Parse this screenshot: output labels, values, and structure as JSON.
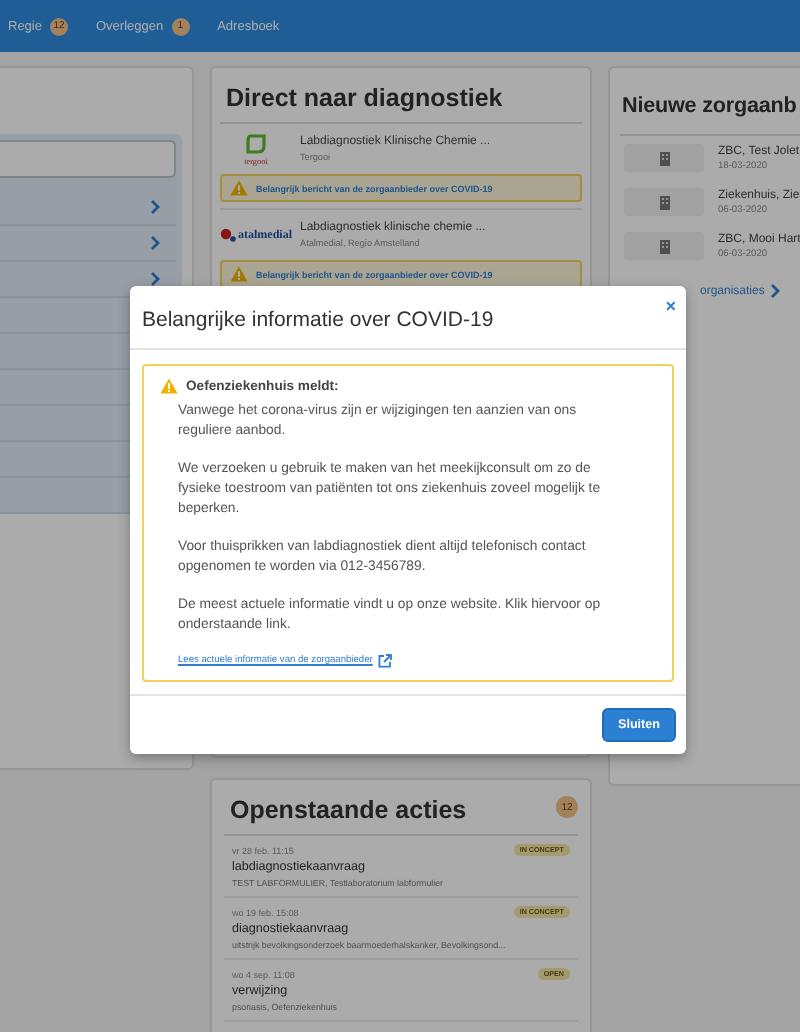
{
  "nav": [
    {
      "label": "Regie",
      "badge": "12"
    },
    {
      "label": "Overleggen",
      "badge": "1"
    },
    {
      "label": "Adresboek"
    }
  ],
  "diagnostics": {
    "title": "Direct naar diagnostiek",
    "providers": [
      {
        "logo_text": "tergooi",
        "kind": "leaf",
        "name": "Labdiagnostiek Klinische Chemie ...",
        "location": "Tergooi",
        "notice": "Belangrijk bericht van de zorgaanbieder over COVID-19"
      },
      {
        "logo_text": "atalmedial",
        "kind": "dots",
        "name": "Labdiagnostiek klinische chemie ...",
        "location": "Atalmedial, Regio Amstelland",
        "notice": "Belangrijk bericht van de zorgaanbieder over COVID-19"
      }
    ]
  },
  "new_providers": {
    "title": "Nieuwe zorgaanb",
    "items": [
      {
        "name": "ZBC, Test Jolet",
        "date": "18-03-2020"
      },
      {
        "name": "Ziekenhuis, Zie",
        "date": "06-03-2020"
      },
      {
        "name": "ZBC, Mooi Hart",
        "date": "06-03-2020"
      }
    ],
    "link": "organisaties"
  },
  "actions": {
    "title": "Openstaande acties",
    "count": "12",
    "items": [
      {
        "date": "vr 28 feb. 11:15",
        "status": "IN CONCEPT",
        "title": "labdiagnostiekaanvraag",
        "detail": "TEST LABFORMULIER, Testlaboratorium labformulier"
      },
      {
        "date": "wo 19 feb. 15:08",
        "status": "IN CONCEPT",
        "title": "diagnostiekaanvraag",
        "detail": "uitstrijk bevolkingsonderzoek baarmoederhalskanker, Bevolkingsond..."
      },
      {
        "date": "wo 4 sep. 11:08",
        "status": "OPEN",
        "title": "verwijzing",
        "detail": "psoriasis, Oefenziekenhuis"
      }
    ]
  },
  "modal": {
    "title": "Belangrijke informatie over COVID-19",
    "close": "×",
    "sender": "Oefenziekenhuis meldt:",
    "paragraphs": [
      "Vanwege het corona-virus zijn er wijzigingen ten aanzien van ons reguliere aanbod.",
      "We verzoeken u gebruik te maken van het meekijkconsult om zo de fysieke toestroom van patiënten tot ons ziekenhuis zoveel mogelijk te beperken.",
      "Voor thuisprikken van labdiagnostiek dient altijd telefonisch contact opgenomen te worden via 012-3456789.",
      "De meest actuele informatie vindt u op onze website. Klik hiervoor op onderstaande link."
    ],
    "link": "Lees actuele informatie van de zorgaanbieder",
    "button": "Sluiten"
  }
}
